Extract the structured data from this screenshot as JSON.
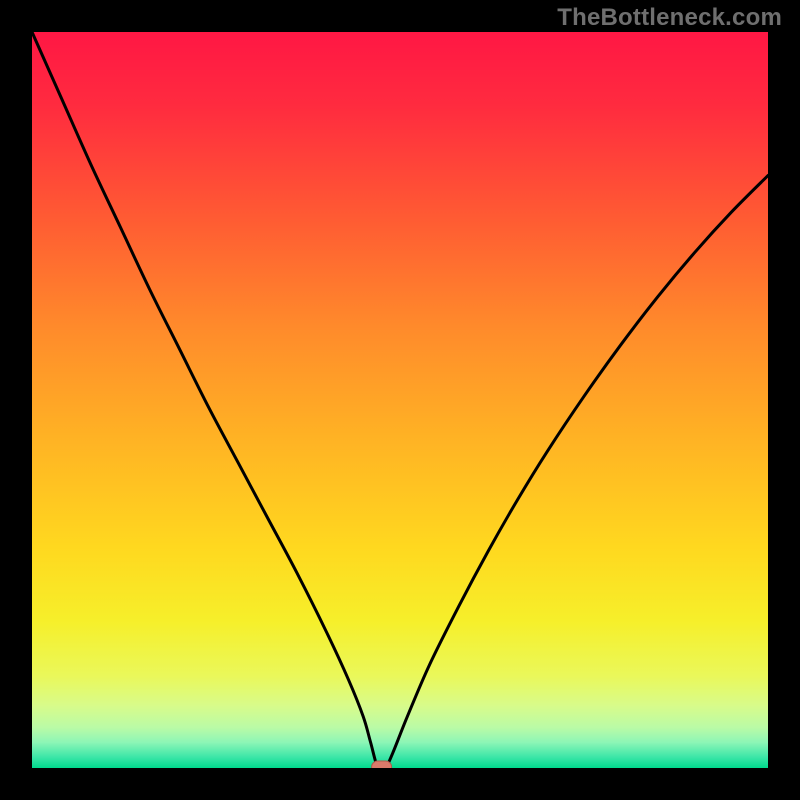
{
  "watermark": "TheBottleneck.com",
  "colors": {
    "frame": "#000000",
    "watermark": "#6f6f6f",
    "curve": "#000000",
    "marker_fill": "#d97a6a",
    "marker_stroke": "#b05a4c",
    "gradient_stops": [
      {
        "offset": 0.0,
        "color": "#ff1744"
      },
      {
        "offset": 0.1,
        "color": "#ff2b3f"
      },
      {
        "offset": 0.25,
        "color": "#ff5a33"
      },
      {
        "offset": 0.4,
        "color": "#ff8a2b"
      },
      {
        "offset": 0.55,
        "color": "#ffb224"
      },
      {
        "offset": 0.7,
        "color": "#ffd81f"
      },
      {
        "offset": 0.8,
        "color": "#f6ef2a"
      },
      {
        "offset": 0.875,
        "color": "#eaf85a"
      },
      {
        "offset": 0.915,
        "color": "#d8fb8a"
      },
      {
        "offset": 0.945,
        "color": "#bafba6"
      },
      {
        "offset": 0.965,
        "color": "#8df6b6"
      },
      {
        "offset": 0.985,
        "color": "#3de6a8"
      },
      {
        "offset": 1.0,
        "color": "#00d98c"
      }
    ]
  },
  "chart_data": {
    "type": "line",
    "title": "",
    "xlabel": "",
    "ylabel": "",
    "xlim": [
      0,
      100
    ],
    "ylim": [
      0,
      100
    ],
    "optimum_x": 47,
    "x": [
      0,
      4,
      8,
      12,
      16,
      20,
      24,
      28,
      32,
      36,
      40,
      43,
      45,
      46,
      47,
      48,
      49,
      51,
      54,
      58,
      62,
      66,
      70,
      75,
      80,
      85,
      90,
      95,
      100
    ],
    "y": [
      100,
      91,
      82,
      73.5,
      65,
      57,
      49,
      41.5,
      34,
      26.5,
      18.5,
      12,
      7,
      3.5,
      0,
      0,
      2,
      7,
      14,
      22,
      29.5,
      36.5,
      43,
      50.5,
      57.5,
      64,
      70,
      75.5,
      80.5
    ],
    "marker": {
      "x": 47.5,
      "y": 0
    }
  }
}
